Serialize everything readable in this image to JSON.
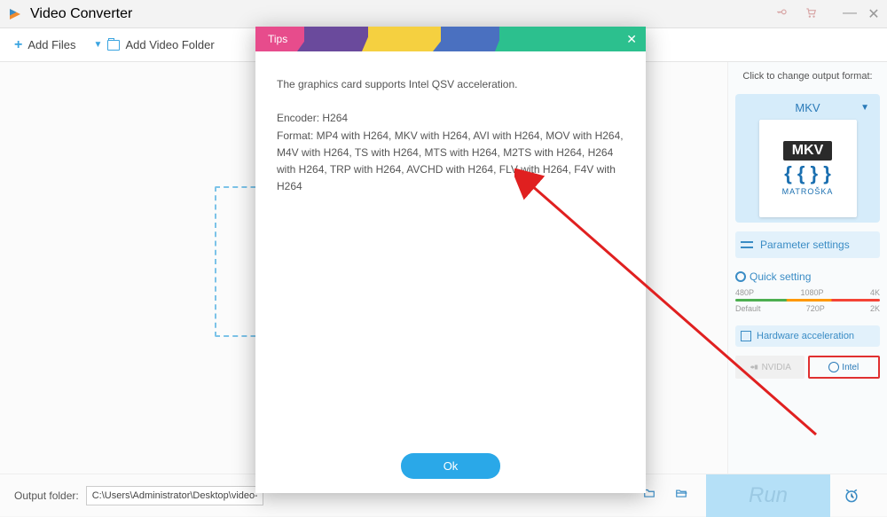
{
  "app": {
    "title": "Video Converter"
  },
  "toolbar": {
    "add_files": "Add Files",
    "add_folder": "Add Video Folder"
  },
  "sidebar": {
    "title": "Click to change output format:",
    "format_name": "MKV",
    "format_badge": "MKV",
    "format_brand": "MATROŠKA",
    "parameter_settings": "Parameter settings",
    "quick_setting": "Quick setting",
    "qs_top": {
      "a": "480P",
      "b": "1080P",
      "c": "4K"
    },
    "qs_bot": {
      "a": "Default",
      "b": "720P",
      "c": "2K"
    },
    "hw_accel": "Hardware acceleration",
    "nvidia": "NVIDIA",
    "intel": "Intel"
  },
  "bottombar": {
    "output_folder_label": "Output folder:",
    "output_folder_value": "C:\\Users\\Administrator\\Desktop\\video-a",
    "run": "Run"
  },
  "modal": {
    "title": "Tips",
    "line1": "The graphics card supports Intel QSV acceleration.",
    "line2": "Encoder: H264",
    "line3": "Format: MP4 with H264, MKV with H264, AVI with H264, MOV with H264, M4V with H264, TS with H264, MTS with H264, M2TS with H264, H264 with H264, TRP with H264, AVCHD with H264, FLV  with H264, F4V with H264",
    "ok": "Ok"
  }
}
